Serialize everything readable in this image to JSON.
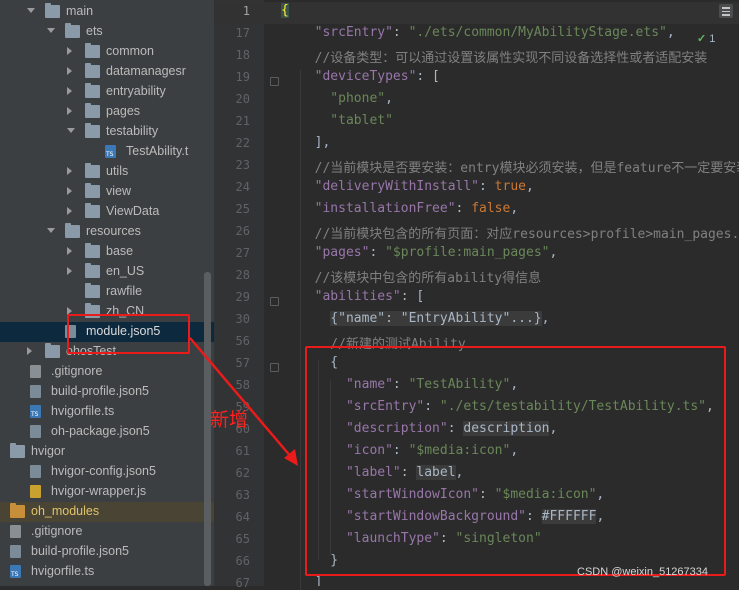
{
  "project_tree": {
    "rows": [
      {
        "label": "main",
        "type": "folder",
        "arrow": "open"
      },
      {
        "label": "ets",
        "type": "folder",
        "arrow": "open"
      },
      {
        "label": "common",
        "type": "folder",
        "arrow": "closed"
      },
      {
        "label": "datamanagesr",
        "type": "folder",
        "arrow": "closed"
      },
      {
        "label": "entryability",
        "type": "folder",
        "arrow": "closed"
      },
      {
        "label": "pages",
        "type": "folder",
        "arrow": "closed"
      },
      {
        "label": "testability",
        "type": "folder",
        "arrow": "open"
      },
      {
        "label": "TestAbility.t",
        "type": "ts",
        "arrow": ""
      },
      {
        "label": "utils",
        "type": "folder",
        "arrow": "closed"
      },
      {
        "label": "view",
        "type": "folder",
        "arrow": "closed"
      },
      {
        "label": "ViewData",
        "type": "folder",
        "arrow": "closed"
      },
      {
        "label": "resources",
        "type": "folder",
        "arrow": "open"
      },
      {
        "label": "base",
        "type": "folder",
        "arrow": "closed"
      },
      {
        "label": "en_US",
        "type": "folder",
        "arrow": "closed"
      },
      {
        "label": "rawfile",
        "type": "folder",
        "arrow": ""
      },
      {
        "label": "zh_CN",
        "type": "folder",
        "arrow": "closed"
      },
      {
        "label": "module.json5",
        "type": "json",
        "arrow": "",
        "selected": true
      },
      {
        "label": "ohosTest",
        "type": "folder",
        "arrow": "closed"
      },
      {
        "label": ".gitignore",
        "type": "git",
        "arrow": ""
      },
      {
        "label": "build-profile.json5",
        "type": "json",
        "arrow": ""
      },
      {
        "label": "hvigorfile.ts",
        "type": "ts",
        "arrow": ""
      },
      {
        "label": "oh-package.json5",
        "type": "json",
        "arrow": ""
      },
      {
        "label": "hvigor",
        "type": "folder",
        "arrow": "open"
      },
      {
        "label": "hvigor-config.json5",
        "type": "json",
        "arrow": ""
      },
      {
        "label": "hvigor-wrapper.js",
        "type": "js",
        "arrow": ""
      },
      {
        "label": "oh_modules",
        "type": "folder-orange",
        "arrow": "closed",
        "highlight": true
      },
      {
        "label": ".gitignore",
        "type": "git",
        "arrow": ""
      },
      {
        "label": "build-profile.json5",
        "type": "json",
        "arrow": ""
      },
      {
        "label": "hvigorfile.ts",
        "type": "ts",
        "arrow": ""
      }
    ]
  },
  "editor": {
    "line_numbers": [
      "1",
      "17",
      "18",
      "19",
      "20",
      "21",
      "22",
      "23",
      "24",
      "25",
      "26",
      "27",
      "28",
      "29",
      "30",
      "56",
      "57",
      "58",
      "59",
      "60",
      "61",
      "62",
      "63",
      "64",
      "65",
      "66",
      "67"
    ],
    "lines": [
      [
        {
          "t": "{",
          "c": "brace-hl"
        }
      ],
      [
        {
          "t": "  \"srcEntry\"",
          "c": "k"
        },
        {
          "t": ": "
        },
        {
          "t": "\"./ets/common/MyAbilityStage.ets\"",
          "c": "s"
        },
        {
          "t": ","
        }
      ],
      [
        {
          "t": "  //设备类型：可以通过设置该属性实现不同设备选择性或者适配安装",
          "c": "c"
        }
      ],
      [
        {
          "t": "  \"deviceTypes\"",
          "c": "k"
        },
        {
          "t": ": ["
        }
      ],
      [
        {
          "t": "    \"phone\"",
          "c": "s"
        },
        {
          "t": ","
        }
      ],
      [
        {
          "t": "    \"tablet\"",
          "c": "s"
        }
      ],
      [
        {
          "t": "  ],"
        }
      ],
      [
        {
          "t": "  //当前模块是否要安装：entry模块必须安装，但是feature不一定要安装",
          "c": "c"
        }
      ],
      [
        {
          "t": "  \"deliveryWithInstall\"",
          "c": "k"
        },
        {
          "t": ": "
        },
        {
          "t": "true",
          "c": "kw"
        },
        {
          "t": ","
        }
      ],
      [
        {
          "t": "  \"installationFree\"",
          "c": "k"
        },
        {
          "t": ": "
        },
        {
          "t": "false",
          "c": "kw"
        },
        {
          "t": ","
        }
      ],
      [
        {
          "t": "  //当前模块包含的所有页面：对应resources>profile>main_pages.json",
          "c": "c"
        }
      ],
      [
        {
          "t": "  \"pages\"",
          "c": "k"
        },
        {
          "t": ": "
        },
        {
          "t": "\"$profile:main_pages\"",
          "c": "s"
        },
        {
          "t": ","
        }
      ],
      [
        {
          "t": "  //该模块中包含的所有ability得信息",
          "c": "c"
        }
      ],
      [
        {
          "t": "  \"abilities\"",
          "c": "k"
        },
        {
          "t": ": ["
        }
      ],
      [
        {
          "t": "    "
        },
        {
          "t": "{\"name\": \"EntryAbility\"...}",
          "c": "hl"
        },
        {
          "t": ","
        }
      ],
      [
        {
          "t": "    //新建的测试Ability",
          "c": "c"
        }
      ],
      [
        {
          "t": "    {"
        }
      ],
      [
        {
          "t": "      \"name\"",
          "c": "k"
        },
        {
          "t": ": "
        },
        {
          "t": "\"TestAbility\"",
          "c": "s"
        },
        {
          "t": ","
        }
      ],
      [
        {
          "t": "      \"srcEntry\"",
          "c": "k"
        },
        {
          "t": ": "
        },
        {
          "t": "\"./ets/testability/TestAbility.ts\"",
          "c": "s"
        },
        {
          "t": ","
        }
      ],
      [
        {
          "t": "      \"description\"",
          "c": "k"
        },
        {
          "t": ": "
        },
        {
          "t": "description",
          "c": "hl"
        },
        {
          "t": ","
        }
      ],
      [
        {
          "t": "      \"icon\"",
          "c": "k"
        },
        {
          "t": ": "
        },
        {
          "t": "\"$media:icon\"",
          "c": "s"
        },
        {
          "t": ","
        }
      ],
      [
        {
          "t": "      \"label\"",
          "c": "k"
        },
        {
          "t": ": "
        },
        {
          "t": "label",
          "c": "hl"
        },
        {
          "t": ","
        }
      ],
      [
        {
          "t": "      \"startWindowIcon\"",
          "c": "k"
        },
        {
          "t": ": "
        },
        {
          "t": "\"$media:icon\"",
          "c": "s"
        },
        {
          "t": ","
        }
      ],
      [
        {
          "t": "      \"startWindowBackground\"",
          "c": "k"
        },
        {
          "t": ": "
        },
        {
          "t": "#FFFFFF",
          "c": "hl"
        },
        {
          "t": ","
        }
      ],
      [
        {
          "t": "      \"launchType\"",
          "c": "k"
        },
        {
          "t": ": "
        },
        {
          "t": "\"singleton\"",
          "c": "s"
        }
      ],
      [
        {
          "t": "    }"
        }
      ],
      [
        {
          "t": "  ]"
        }
      ]
    ]
  },
  "inspection_badge": {
    "check": "✓",
    "count": "1"
  },
  "annotation": {
    "label": "新增",
    "color": "#ea1b1b"
  },
  "watermark": "CSDN @weixin_51267334"
}
